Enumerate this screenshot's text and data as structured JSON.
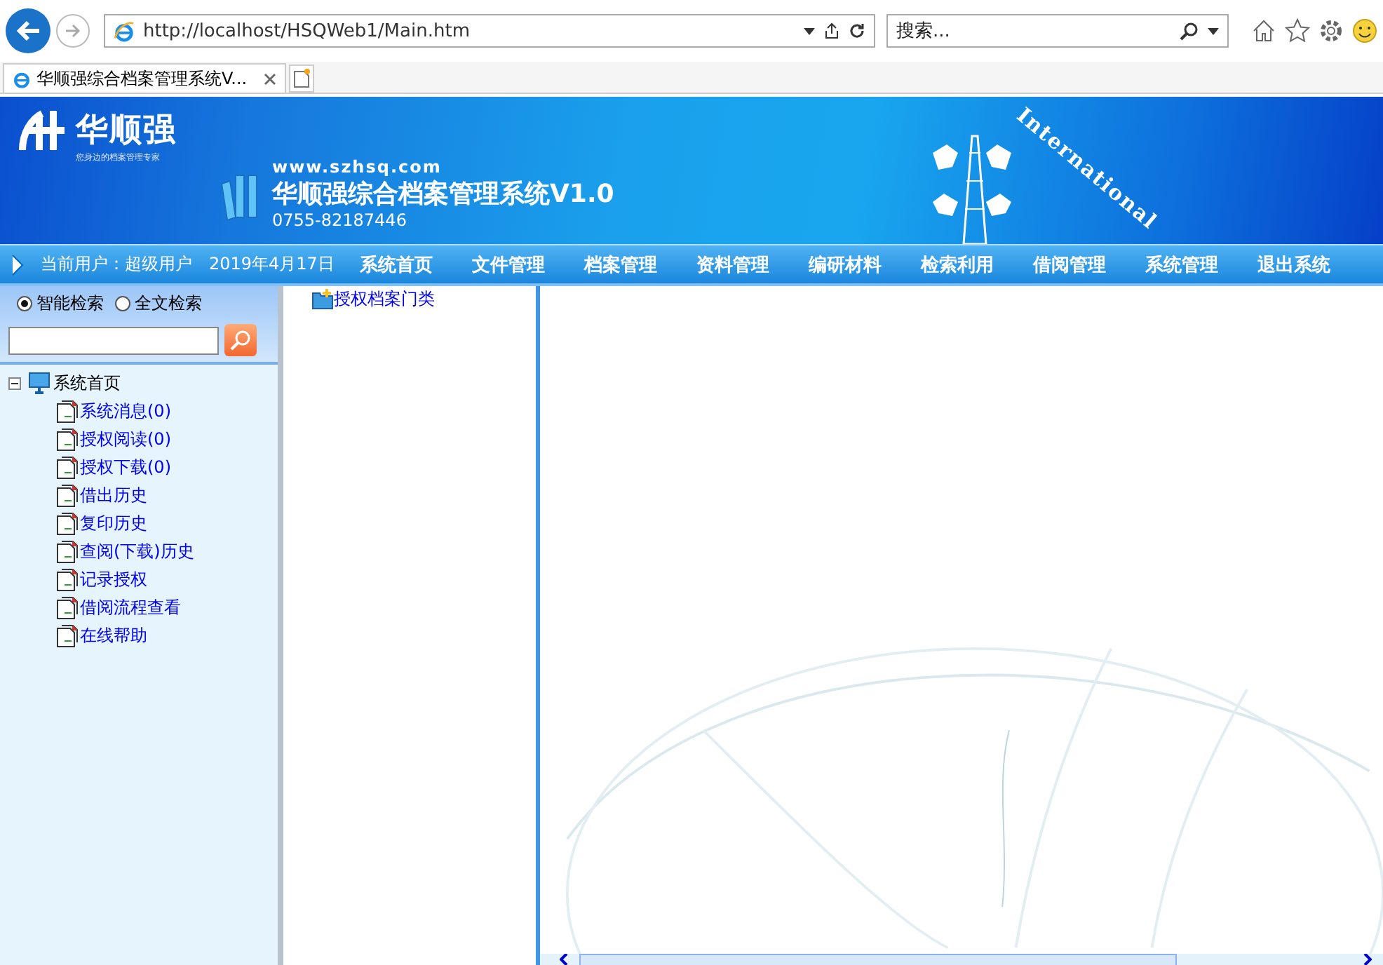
{
  "browser": {
    "address": "http://localhost/HSQWeb1/Main.htm",
    "search_placeholder": "搜索...",
    "tabs": [
      {
        "title": "华顺强综合档案管理系统V...",
        "selected": true
      }
    ]
  },
  "banner": {
    "logo": "华顺强",
    "slogan": "您身边的档案管理专家",
    "url": "www.szhsq.com",
    "title": "华顺强综合档案管理系统V1.0",
    "phone": "0755-82187446",
    "emblem_text": "International"
  },
  "nav": {
    "user": "当前用户：超级用户",
    "date": "2019年4月17日",
    "items": [
      "系统首页",
      "文件管理",
      "档案管理",
      "资料管理",
      "编研材料",
      "检索利用",
      "借阅管理",
      "系统管理",
      "退出系统"
    ]
  },
  "search": {
    "modes": [
      {
        "label": "智能检索",
        "selected": true
      },
      {
        "label": "全文检索",
        "selected": false
      }
    ]
  },
  "tree": {
    "label": "系统首页",
    "expanded": true,
    "children": [
      {
        "label": "系统消息(0)"
      },
      {
        "label": "授权阅读(0)"
      },
      {
        "label": "授权下载(0)"
      },
      {
        "label": "借出历史"
      },
      {
        "label": "复印历史"
      },
      {
        "label": "查阅(下载)历史"
      },
      {
        "label": "记录授权"
      },
      {
        "label": "借阅流程查看"
      },
      {
        "label": "在线帮助"
      }
    ]
  },
  "middle": {
    "items": [
      {
        "label": "授权档案门类"
      }
    ]
  }
}
